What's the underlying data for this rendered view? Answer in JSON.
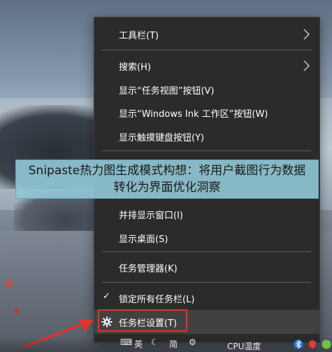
{
  "menu": {
    "items": [
      {
        "label": "工具栏(T)",
        "submenu": true
      },
      {
        "label": "搜索(H)",
        "submenu": true
      },
      {
        "label": "显示“任务视图”按钮(V)"
      },
      {
        "label": "显示“Windows Ink 工作区”按钮(W)"
      },
      {
        "label": "显示触摸键盘按钮(Y)"
      },
      {
        "label": "并排显示窗口(I)"
      },
      {
        "label": "显示桌面(S)"
      },
      {
        "label": "任务管理器(K)"
      },
      {
        "label": "锁定所有任务栏(L)",
        "checked": true
      },
      {
        "label": "任务栏设置(T)",
        "icon": "gear-icon",
        "highlighted": true
      }
    ]
  },
  "banner": {
    "line1": "Snipaste热力图生成模式构想：将用户截图行为数据",
    "line2": "转化为界面优化洞察"
  },
  "taskbar": {
    "partial_text_1": "英",
    "partial_text_2": "简",
    "cpu_label": "CPU温度"
  },
  "colors": {
    "menu_bg": "#2b2b2b",
    "highlight_box": "#e0342d",
    "banner_bg": "#8fc4d4"
  }
}
